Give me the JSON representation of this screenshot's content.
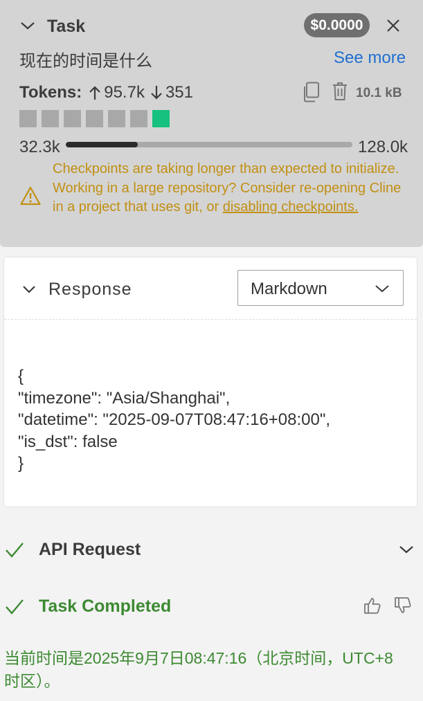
{
  "task": {
    "title": "Task",
    "cost": "$0.0000",
    "question": "现在的时间是什么",
    "see_more": "See more",
    "tokens_label": "Tokens:",
    "tokens_in": "95.7k",
    "tokens_out": "351",
    "cache_size": "10.1 kB",
    "checkpoint_count": 7,
    "active_checkpoint": 7,
    "context_used": "32.3k",
    "context_max": "128.0k",
    "context_progress": 0.252,
    "warning_text": "Checkpoints are taking longer than expected to initialize. Working in a large repository? Consider re-opening Cline in a project that uses git, or",
    "warning_link": "disabling checkpoints.",
    "colors": {
      "header_bg": "#d4d4d4",
      "cost_badge": "#6f6f6f",
      "link": "#1f6fd0",
      "warning": "#c18f13",
      "active_checkpoint": "#16c07f"
    }
  },
  "response": {
    "title": "Response",
    "format_selected": "Markdown",
    "content": "{\n\"timezone\": \"Asia/Shanghai\",\n\"datetime\": \"2025-09-07T08:47:16+08:00\",\n\"is_dst\": false\n}"
  },
  "api_request": {
    "label": "API Request",
    "status_icon": "check-icon"
  },
  "task_completed": {
    "label": "Task Completed",
    "result": "当前时间是2025年9月7日08:47:16（北京时间，UTC+8时区）。",
    "color": "#3d8a32"
  }
}
